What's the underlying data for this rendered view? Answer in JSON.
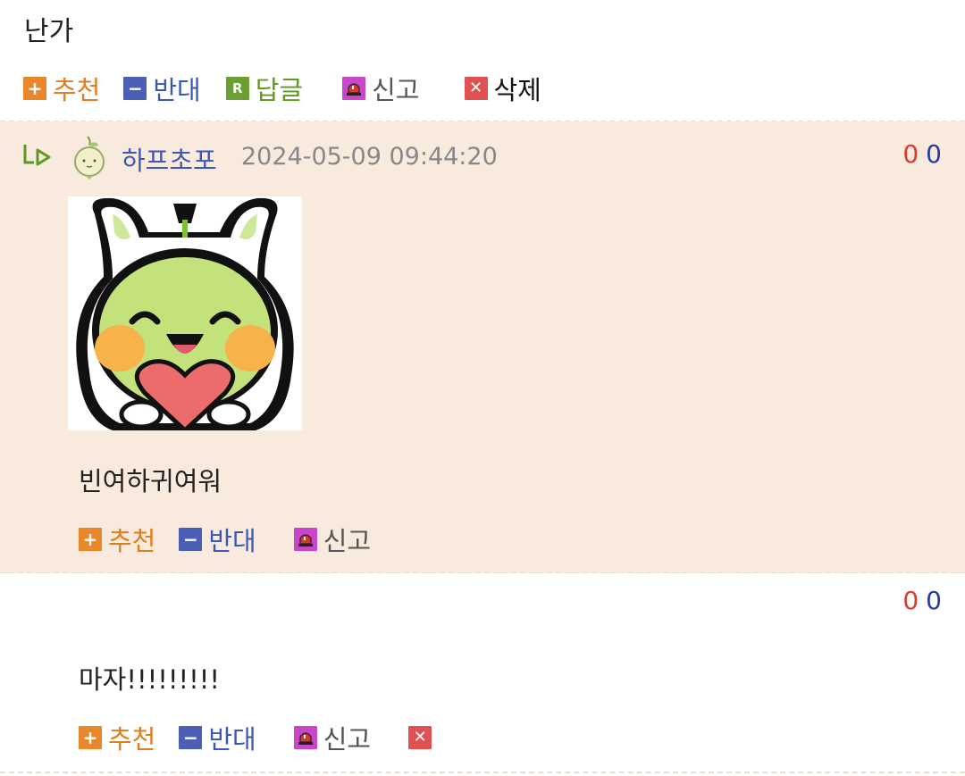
{
  "top": {
    "text": "난가",
    "actions": {
      "recommend": "추천",
      "oppose": "반대",
      "reply": "답글",
      "report": "신고",
      "delete": "삭제"
    }
  },
  "reply_comment": {
    "username": "하프초포",
    "datetime": "2024-05-09 09:44:20",
    "votes_up": "0",
    "votes_down": "0",
    "text": "빈여하귀여워",
    "actions": {
      "recommend": "추천",
      "oppose": "반대",
      "report": "신고"
    }
  },
  "second_comment": {
    "votes_up": "0",
    "votes_down": "0",
    "text": "마자!!!!!!!!!",
    "actions": {
      "recommend": "추천",
      "oppose": "반대",
      "report": "신고"
    }
  },
  "icons": {
    "plus": "plus-icon",
    "minus": "minus-icon",
    "reply": "reply-icon",
    "report": "siren-icon",
    "delete": "close-icon",
    "reply_arrow": "reply-arrow-icon"
  },
  "colors": {
    "reply_bg": "#f8eadd",
    "recommend": "#e8872c",
    "oppose": "#4b5fb5",
    "reply": "#6b9f34",
    "report": "#c945c9",
    "delete": "#e05252",
    "username": "#3c58b6",
    "vote_up": "#e23a2a",
    "vote_down": "#2a3aa0"
  }
}
